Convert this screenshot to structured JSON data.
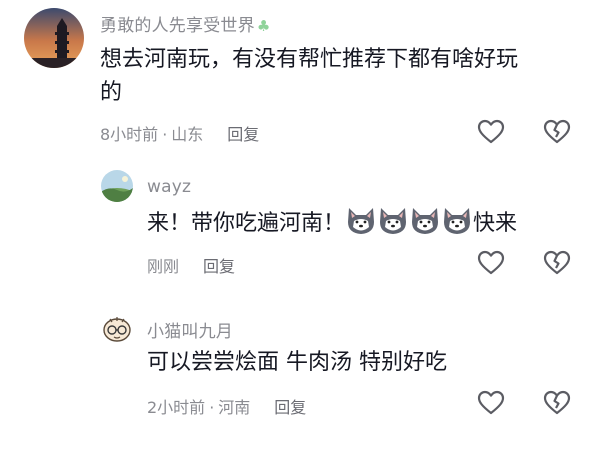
{
  "comments": [
    {
      "username": "勇敢的人先享受世界",
      "badge_icon": "clover-icon",
      "text_line1": "想去河南玩，有没有帮忙推荐下都有啥好玩",
      "text_line2": "的",
      "time": "8小时前",
      "location": "山东",
      "reply_label": "回复"
    },
    {
      "username": "wayz",
      "text": "来！带你吃遍河南！",
      "emoji_icon": "husky-dog-emoji",
      "emoji_count": 4,
      "text_suffix": "快来",
      "time": "刚刚",
      "reply_label": "回复"
    },
    {
      "username": "小猫叫九月",
      "text": "可以尝尝烩面 牛肉汤 特别好吃",
      "time": "2小时前",
      "location": "河南",
      "reply_label": "回复"
    }
  ],
  "separator": "·",
  "icons": {
    "like": "heart-outline-icon",
    "dislike": "broken-heart-icon"
  },
  "colors": {
    "text": "#161823",
    "secondary": "#8a8b91",
    "icon": "#5b5c63"
  }
}
